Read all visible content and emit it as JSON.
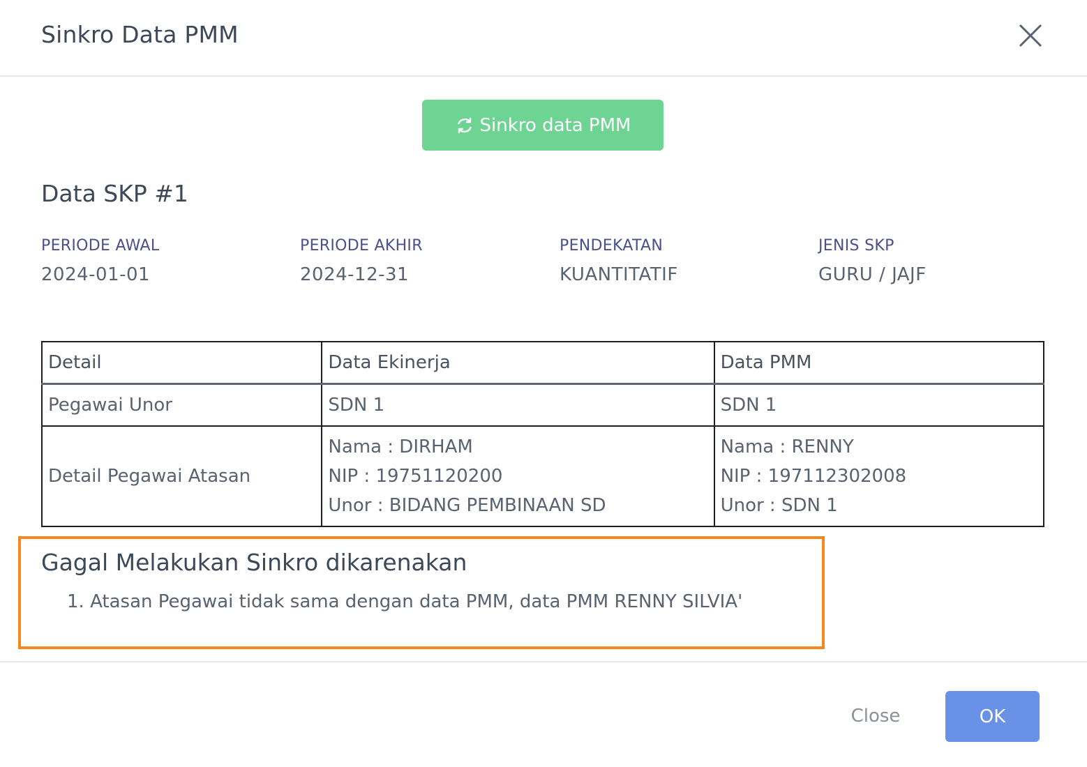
{
  "modal": {
    "title": "Sinkro Data PMM"
  },
  "sync_button": {
    "label": "Sinkro data PMM",
    "icon": "refresh-icon",
    "color": "#6ed493"
  },
  "skp": {
    "title": "Data SKP #1",
    "fields": [
      {
        "label": "PERIODE AWAL",
        "value": "2024-01-01"
      },
      {
        "label": "PERIODE AKHIR",
        "value": "2024-12-31"
      },
      {
        "label": "PENDEKATAN",
        "value": "KUANTITATIF"
      },
      {
        "label": "JENIS SKP",
        "value": "GURU / JAJF"
      }
    ]
  },
  "comparison_table": {
    "headers": [
      "Detail",
      "Data Ekinerja",
      "Data PMM"
    ],
    "rows": [
      {
        "detail": "Pegawai Unor",
        "ekinerja": [
          "SDN 1"
        ],
        "pmm": [
          "SDN 1"
        ]
      },
      {
        "detail": "Detail Pegawai Atasan",
        "ekinerja": [
          "Nama : DIRHAM",
          "NIP : 19751120200",
          "Unor : BIDANG PEMBINAAN SD"
        ],
        "pmm": [
          "Nama : RENNY",
          "NIP : 197112302008",
          "Unor : SDN 1"
        ]
      }
    ]
  },
  "error": {
    "title": "Gagal Melakukan Sinkro dikarenakan",
    "items": [
      "1. Atasan Pegawai tidak sama dengan data PMM, data PMM RENNY SILVIA'"
    ],
    "highlight_color": "#f5871f"
  },
  "footer": {
    "close_label": "Close",
    "ok_label": "OK",
    "ok_color": "#6a91e8"
  }
}
